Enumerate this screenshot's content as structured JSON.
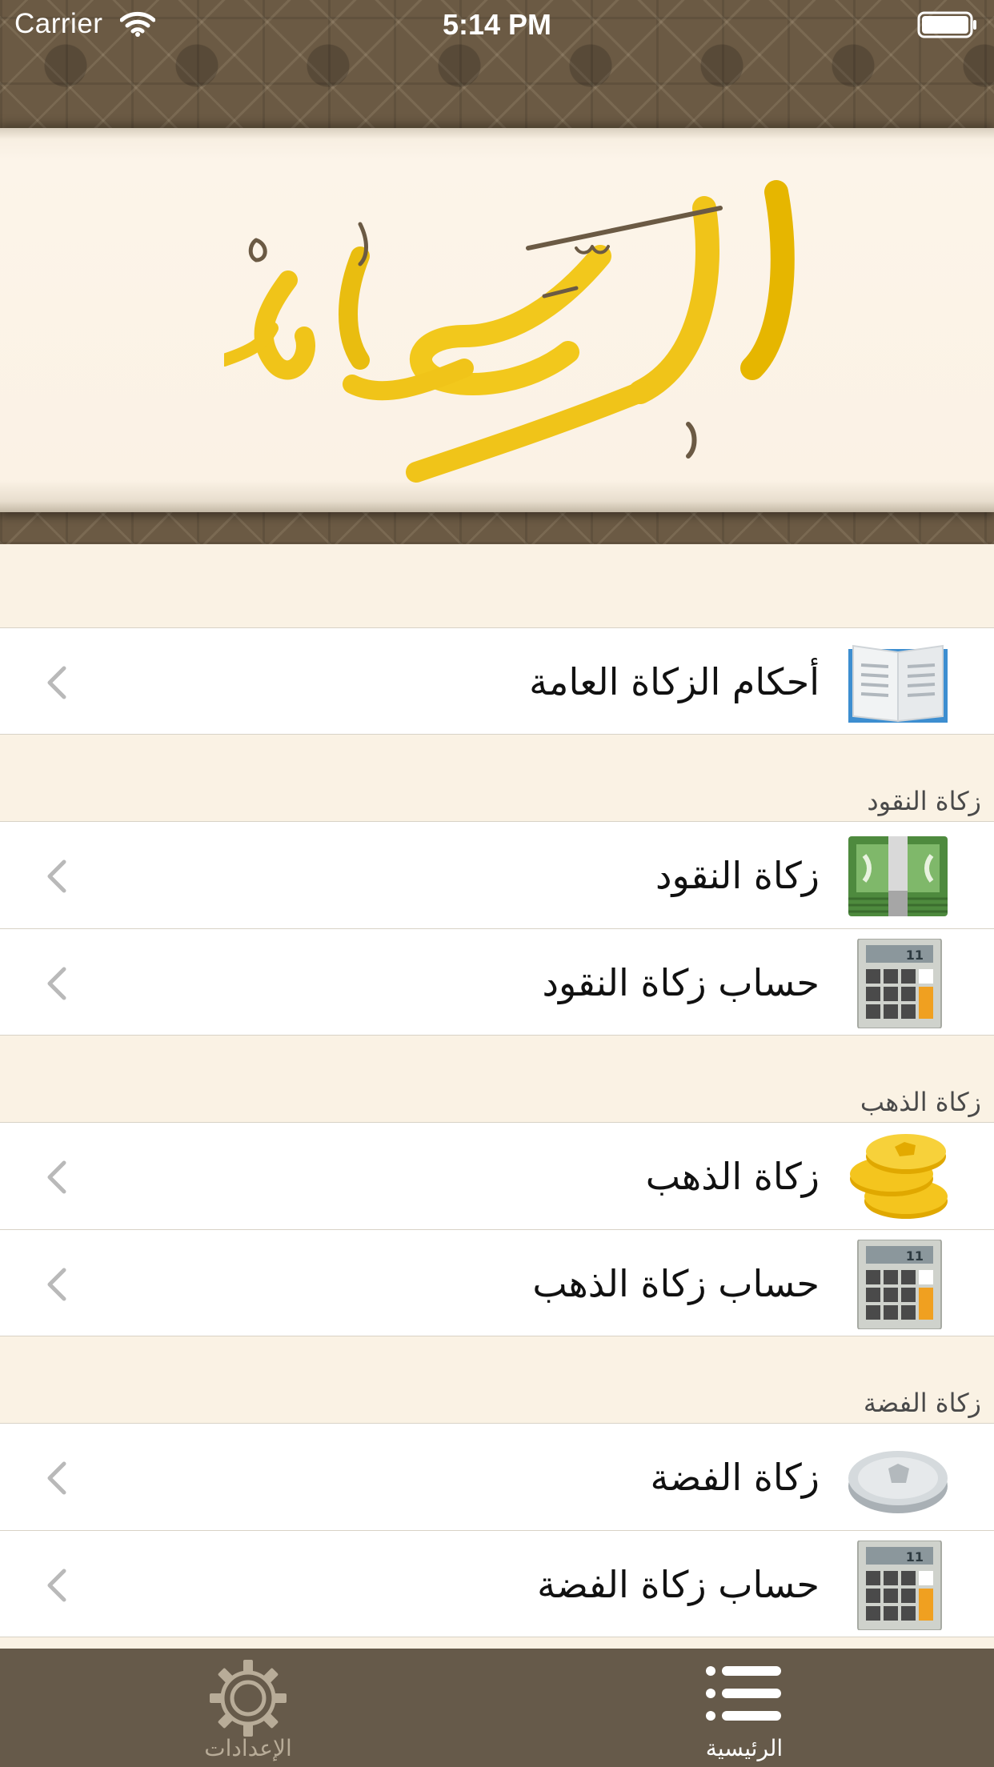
{
  "status_bar": {
    "carrier": "Carrier",
    "time": "5:14 PM"
  },
  "banner": {
    "logo": "الزكاة"
  },
  "colors": {
    "tab_bar": "#665a4a",
    "background": "#faf2e4",
    "gold": "#f0c419"
  },
  "list": {
    "general": {
      "title": "أحكام الزكاة العامة",
      "icon": "book-icon"
    },
    "money": {
      "header": "زكاة النقود",
      "items": [
        {
          "title": "زكاة النقود",
          "icon": "banknotes-icon"
        },
        {
          "title": "حساب زكاة النقود",
          "icon": "calculator-icon"
        }
      ]
    },
    "gold": {
      "header": "زكاة الذهب",
      "items": [
        {
          "title": "زكاة الذهب",
          "icon": "gold-coins-icon"
        },
        {
          "title": "حساب زكاة الذهب",
          "icon": "calculator-icon"
        }
      ]
    },
    "silver": {
      "header": "زكاة الفضة",
      "items": [
        {
          "title": "زكاة الفضة",
          "icon": "silver-coin-icon"
        },
        {
          "title": "حساب زكاة الفضة",
          "icon": "calculator-icon"
        }
      ]
    }
  },
  "tabbar": {
    "settings": {
      "label": "الإعدادات",
      "icon": "gear-icon"
    },
    "home": {
      "label": "الرئيسية",
      "icon": "list-icon"
    }
  }
}
